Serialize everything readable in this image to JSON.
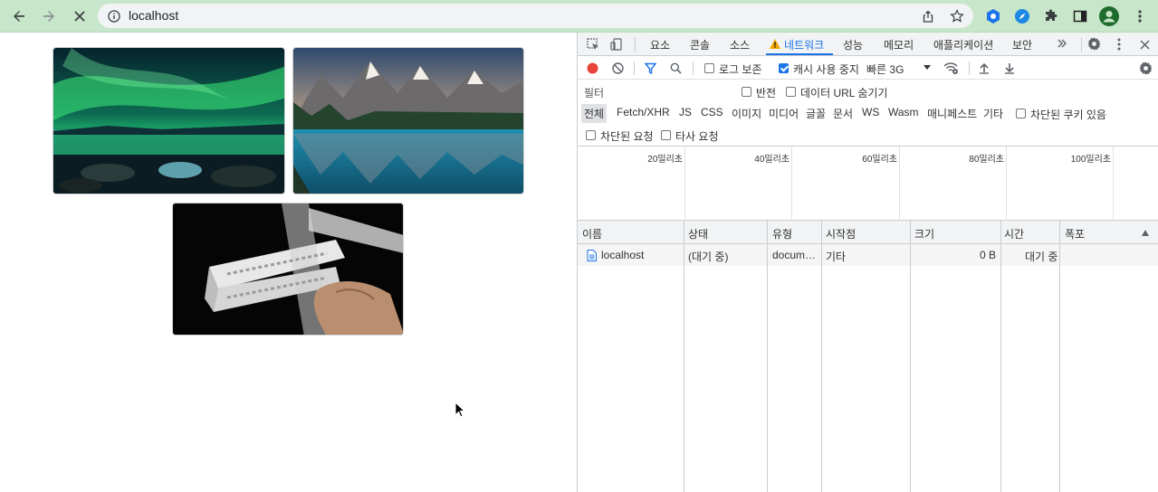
{
  "browser": {
    "url": "localhost",
    "icons": [
      "back-icon",
      "forward-icon",
      "stop-loading-icon",
      "info-icon",
      "share-icon",
      "bookmark-star-icon",
      "extension-blue-icon",
      "extension-safari-icon",
      "extensions-puzzle-icon",
      "side-panel-icon",
      "profile-avatar-icon",
      "chrome-menu-icon"
    ]
  },
  "devtools": {
    "tabs": [
      "요소",
      "콘솔",
      "소스",
      "네트워크",
      "성능",
      "메모리",
      "애플리케이션",
      "보안"
    ],
    "active_tab": "네트워크",
    "controls": {
      "preserve_log": "로그 보존",
      "disable_cache": "캐시 사용 중지",
      "throttle": "빠른 3G"
    },
    "filter": {
      "placeholder": "필터",
      "invert": "반전",
      "hide_data_urls": "데이터 URL 숨기기",
      "types": [
        "전체",
        "Fetch/XHR",
        "JS",
        "CSS",
        "이미지",
        "미디어",
        "글꼴",
        "문서",
        "WS",
        "Wasm",
        "매니페스트",
        "기타"
      ],
      "blocked_cookies": "차단된 쿠키 있음",
      "blocked_requests": "차단된 요청",
      "third_party": "타사 요청"
    },
    "timeline_ticks": [
      "20밀리초",
      "40밀리초",
      "60밀리초",
      "80밀리초",
      "100밀리초"
    ],
    "columns": [
      "이름",
      "상태",
      "유형",
      "시작점",
      "크기",
      "시간",
      "폭포"
    ],
    "rows": [
      {
        "name": "localhost",
        "status": "(대기 중)",
        "type": "docum…",
        "initiator": "기타",
        "size": "0 B",
        "time": "대기 중"
      }
    ]
  },
  "colors": {
    "toolbar": "#c8e6c9",
    "accent": "#1a73e8",
    "record": "#e8453c"
  }
}
